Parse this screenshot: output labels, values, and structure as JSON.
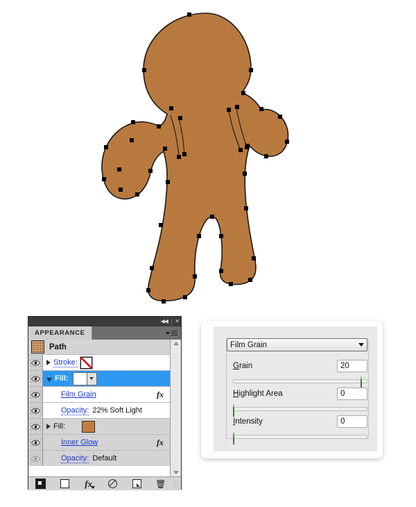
{
  "artwork": {
    "name": "gingerbread-man-path",
    "fill_color": "#c07f42",
    "stroke_color": "#1a1a1a",
    "anchor_color": "#000000"
  },
  "appearance_panel": {
    "title": "APPEARANCE",
    "titlebar": {
      "collapse_icon": "collapse-to-icons",
      "collapse_glyph": "◀◀",
      "close_glyph": "✕",
      "separator": "|"
    },
    "menu_icon": "panel-menu-icon",
    "object_row": {
      "label": "Path",
      "thumbnail": "path-thumbnail"
    },
    "rows": [
      {
        "id": "stroke",
        "label": "Stroke:",
        "label_style": "link",
        "visible": true,
        "disclosure": "collapsed",
        "swatch": "none",
        "selected": false,
        "indent": false,
        "fx": false
      },
      {
        "id": "fill",
        "label": "Fill:",
        "label_style": "selected",
        "visible": true,
        "disclosure": "expanded",
        "swatch": "white-with-dropdown",
        "selected": true,
        "indent": false,
        "fx": false
      },
      {
        "id": "film-grain",
        "label": "Film Grain",
        "label_style": "link",
        "visible": true,
        "disclosure": "none",
        "selected": false,
        "indent": true,
        "fx": true,
        "fx_glyph": "fx"
      },
      {
        "id": "opacity-film-grain",
        "label": "Opacity:",
        "value": "22% Soft Light",
        "label_style": "link-dotted",
        "visible": true,
        "disclosure": "none",
        "selected": false,
        "indent": true,
        "fx": false
      },
      {
        "id": "fill-2",
        "label": "Fill:",
        "label_style": "plain",
        "visible": true,
        "disclosure": "collapsed",
        "swatch": "brown",
        "swatch_color": "#c07f42",
        "selected": false,
        "indent": false,
        "fx": false
      },
      {
        "id": "inner-glow",
        "label": "Inner Glow",
        "label_style": "link",
        "visible": true,
        "disclosure": "none",
        "selected": false,
        "indent": true,
        "fx": true,
        "fx_glyph": "fx"
      },
      {
        "id": "opacity-inner-glow",
        "label": "Opacity:",
        "value": "Default",
        "label_style": "link-dotted",
        "visible": false,
        "disclosure": "none",
        "selected": false,
        "indent": true,
        "fx": false
      }
    ],
    "footer_buttons": [
      {
        "id": "add-new-fill",
        "icon": "new-fill-icon"
      },
      {
        "id": "add-new-stroke",
        "icon": "new-stroke-icon"
      },
      {
        "id": "add-new-effect",
        "icon": "fx-icon",
        "glyph": "fx"
      },
      {
        "id": "clear-appearance",
        "icon": "clear-appearance-icon"
      },
      {
        "id": "duplicate-item",
        "icon": "duplicate-icon"
      },
      {
        "id": "delete-item",
        "icon": "trash-icon",
        "glyph": "🗑"
      }
    ],
    "scrollbar": {
      "up_arrow": "scroll-up-arrow",
      "down_arrow": "scroll-down-arrow"
    }
  },
  "filter_dialog": {
    "effect_select": {
      "value": "Film Grain",
      "arrow_icon": "chevron-down-icon"
    },
    "controls": [
      {
        "id": "grain",
        "label": "Grain",
        "mnemonic": "G",
        "value": "20",
        "slider_percent": 100,
        "min": 0,
        "max": 20
      },
      {
        "id": "highlight-area",
        "label": "Highlight Area",
        "mnemonic": "H",
        "value": "0",
        "slider_percent": 0,
        "min": 0,
        "max": 20
      },
      {
        "id": "intensity",
        "label": "Intensity",
        "mnemonic": "I",
        "value": "0",
        "slider_percent": 0,
        "min": 0,
        "max": 10
      }
    ]
  }
}
